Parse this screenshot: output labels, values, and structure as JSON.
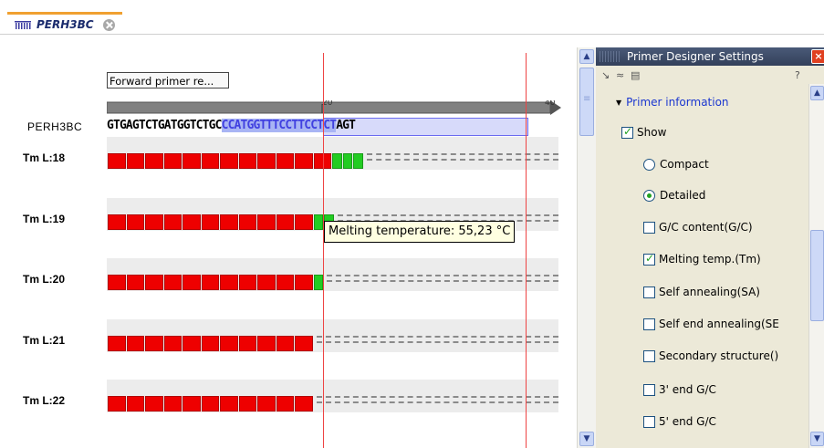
{
  "tab": {
    "icon": "sequence-icon",
    "title": "PERH3BC",
    "close_icon": "close-icon"
  },
  "sequence": {
    "name": "PERH3BC",
    "bases_before": "GTGAGTCTGATGGTCTGC",
    "bases_primer": "CCATGGTTTCCTTCCTCT",
    "bases_after": "AGT",
    "primer_region_label": "Forward primer re...",
    "ruler_ticks": [
      "20",
      "40"
    ]
  },
  "primer_rows": [
    {
      "label": "Tm L:18",
      "red": 12,
      "green": 3,
      "total": 15
    },
    {
      "label": "Tm L:19",
      "red": 11,
      "green": 2,
      "total": 13
    },
    {
      "label": "Tm L:20",
      "red": 11,
      "green": 1,
      "total": 12
    },
    {
      "label": "Tm L:21",
      "red": 11,
      "green": 0,
      "total": 11
    },
    {
      "label": "Tm L:22",
      "red": 11,
      "green": 0,
      "total": 11
    }
  ],
  "tooltip": {
    "text": "Melting temperature: 55,23 °C"
  },
  "colors": {
    "low_tm": "#ee0000",
    "ok_tm": "#22cc22",
    "selection": "#a8b4f4",
    "boundary_line": "#ee4444"
  },
  "settings_panel": {
    "title": "Primer Designer Settings",
    "tool_help": "?",
    "section_header": "Primer information",
    "show": {
      "label": "Show",
      "checked": true
    },
    "mode_compact": {
      "label": "Compact",
      "selected": false
    },
    "mode_detailed": {
      "label": "Detailed",
      "selected": true
    },
    "options": [
      {
        "label": "G/C content(G/C)",
        "checked": false
      },
      {
        "label": "Melting temp.(Tm)",
        "checked": true
      },
      {
        "label": "Self annealing(SA)",
        "checked": false
      },
      {
        "label": "Self end annealing(SE",
        "checked": false
      },
      {
        "label": "Secondary structure()",
        "checked": false
      },
      {
        "label": "3' end G/C",
        "checked": false
      },
      {
        "label": "5' end G/C",
        "checked": false
      }
    ]
  }
}
